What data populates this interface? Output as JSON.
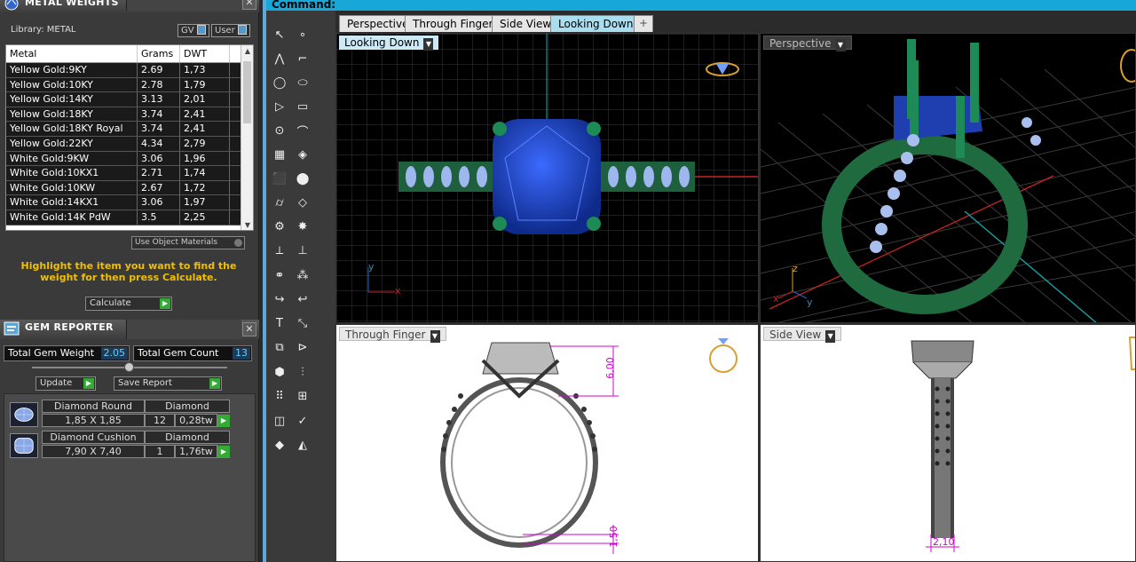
{
  "command_bar": {
    "text": "Command:"
  },
  "metal_panel": {
    "title": "METAL WEIGHTS",
    "library_label": "Library: METAL",
    "chip_gv": "GV",
    "chip_user": "User",
    "columns": [
      "Metal",
      "Grams",
      "DWT"
    ],
    "rows": [
      [
        "Yellow Gold:9KY",
        "2.69",
        "1,73"
      ],
      [
        "Yellow Gold:10KY",
        "2.78",
        "1,79"
      ],
      [
        "Yellow Gold:14KY",
        "3.13",
        "2,01"
      ],
      [
        "Yellow Gold:18KY",
        "3.74",
        "2,41"
      ],
      [
        "Yellow Gold:18KY Royal",
        "3.74",
        "2,41"
      ],
      [
        "Yellow Gold:22KY",
        "4.34",
        "2,79"
      ],
      [
        "White Gold:9KW",
        "3.06",
        "1,96"
      ],
      [
        "White Gold:10KX1",
        "2.71",
        "1,74"
      ],
      [
        "White Gold:10KW",
        "2.67",
        "1,72"
      ],
      [
        "White Gold:14KX1",
        "3.06",
        "1,97"
      ],
      [
        "White Gold:14K PdW",
        "3.5",
        "2,25"
      ]
    ],
    "use_object_materials": "Use Object Materials",
    "hint": "Highlight the item you want to find the weight for then press Calculate.",
    "calculate_label": "Calculate"
  },
  "gem_panel": {
    "title": "GEM REPORTER",
    "total_weight_label": "Total Gem Weight",
    "total_weight_value": "2.05",
    "total_count_label": "Total Gem Count",
    "total_count_value": "13",
    "update_label": "Update",
    "save_report_label": "Save Report",
    "gems": [
      {
        "name": "Diamond Round",
        "material": "Diamond",
        "size": "1,85 X 1,85",
        "count": "12",
        "weight": "0,28tw"
      },
      {
        "name": "Diamond Cushion",
        "material": "Diamond",
        "size": "7,90 X 7,40",
        "count": "1",
        "weight": "1,76tw"
      }
    ]
  },
  "tabs": [
    {
      "label": "Perspective",
      "active": false
    },
    {
      "label": "Through Finger",
      "active": false
    },
    {
      "label": "Side View",
      "active": false
    },
    {
      "label": "Looking Down",
      "active": true
    },
    {
      "label": "+",
      "active": false
    }
  ],
  "viewports": {
    "top_left": {
      "label": "Looking Down",
      "axis_y": "y",
      "axis_x": "x"
    },
    "top_right": {
      "label": "Perspective",
      "axis_z": "z",
      "axis_x": "x",
      "axis_y": "y"
    },
    "bottom_left": {
      "label": "Through Finger",
      "dim_top": "6,00",
      "dim_bottom": "1,50"
    },
    "bottom_right": {
      "label": "Side View",
      "dim_width": "2,10"
    }
  },
  "colors": {
    "accent": "#17a8d8",
    "dimension": "#d400d4",
    "ring_metal": "#1f6b3f",
    "stone": "#1a3fb0",
    "hint": "#f0c000"
  }
}
